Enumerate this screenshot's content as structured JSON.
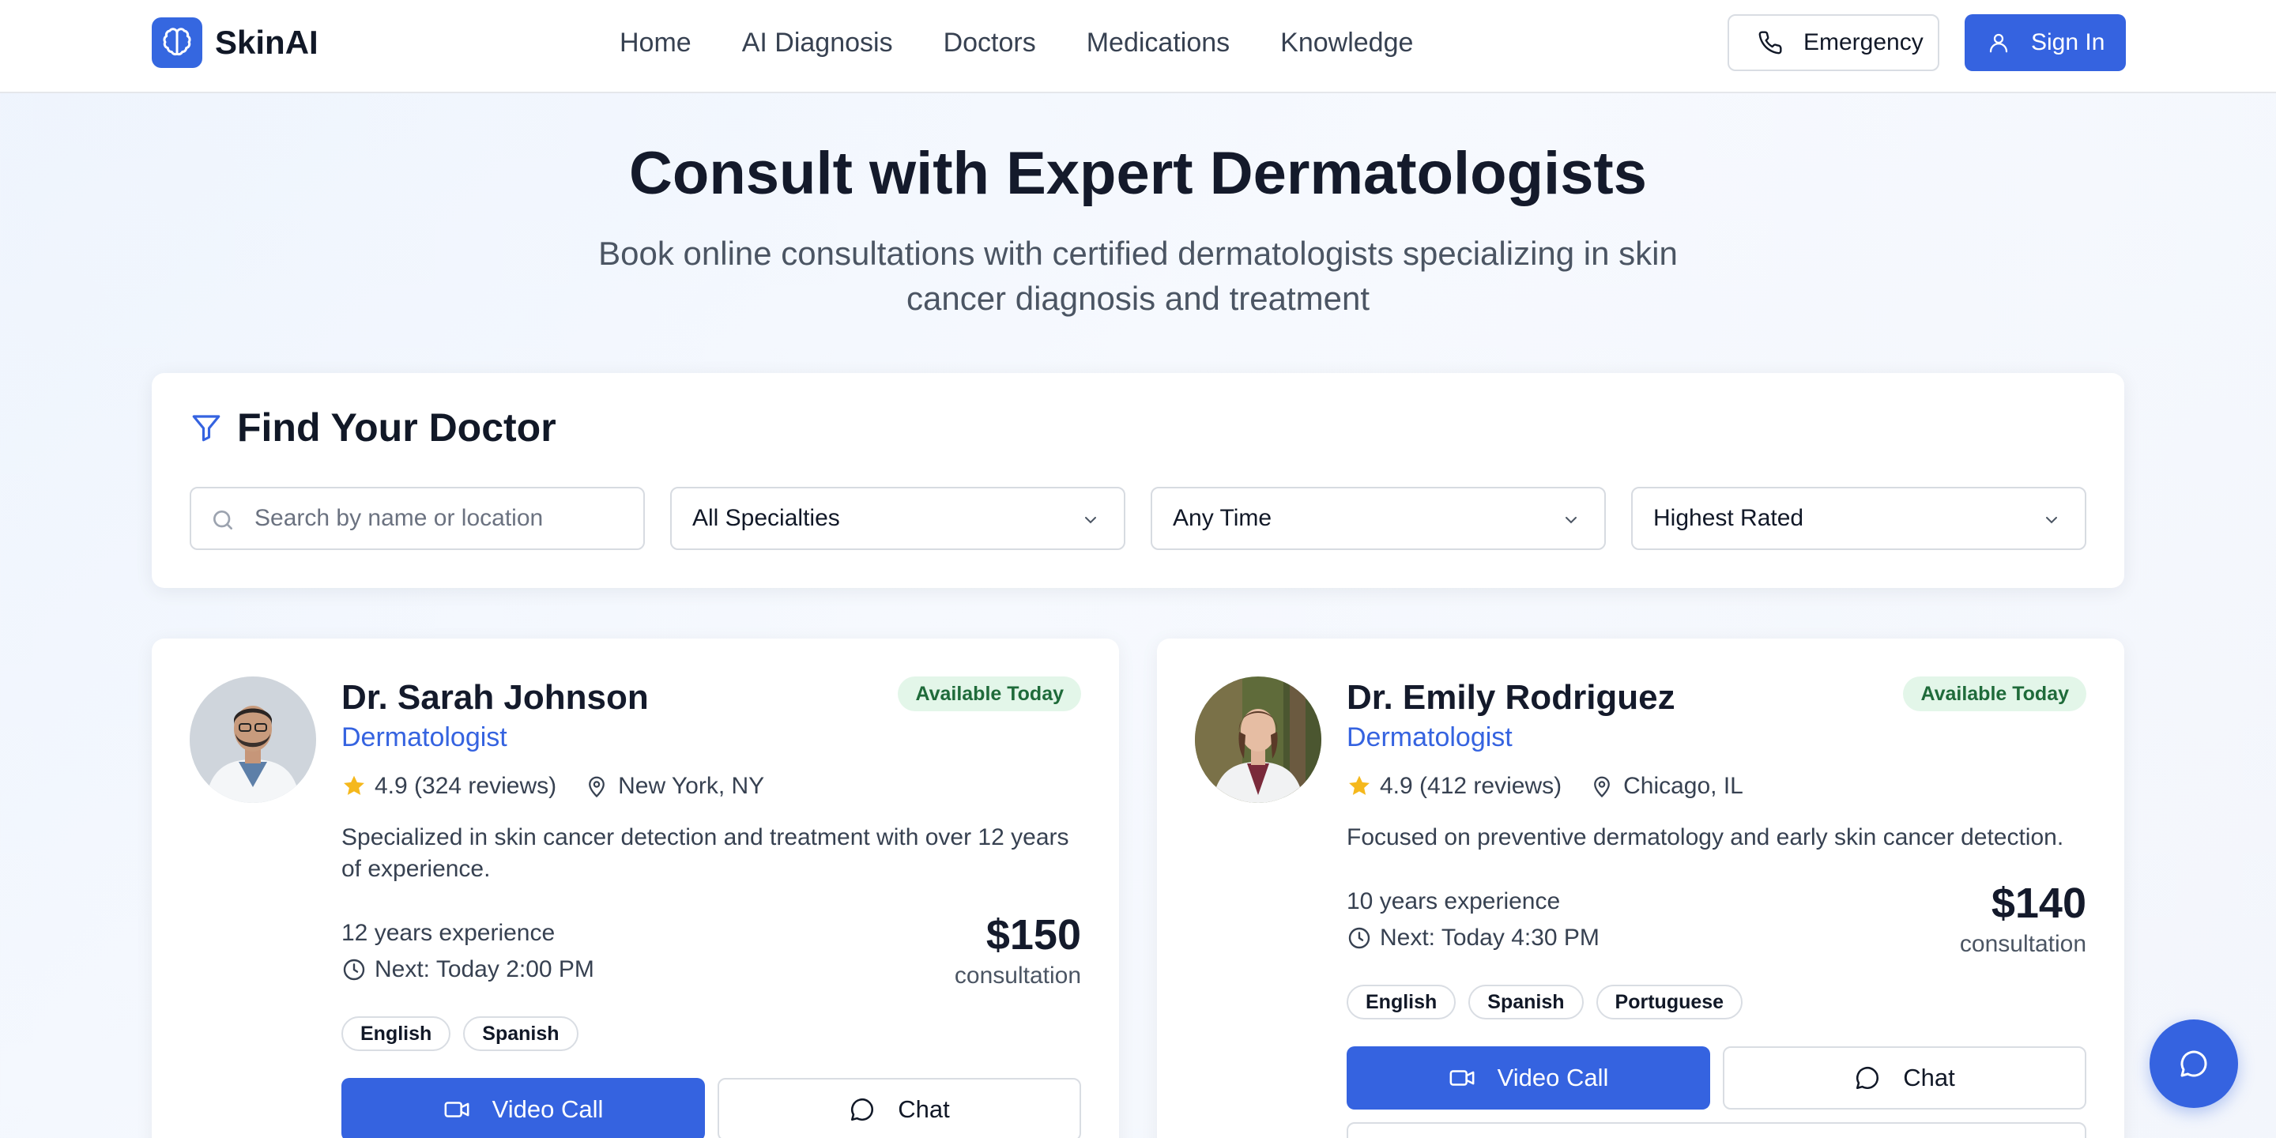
{
  "header": {
    "logo_text": "SkinAI",
    "nav": [
      "Home",
      "AI Diagnosis",
      "Doctors",
      "Medications",
      "Knowledge"
    ],
    "emergency_label": "Emergency",
    "signin_label": "Sign In"
  },
  "hero": {
    "title": "Consult with Expert Dermatologists",
    "subtitle": "Book online consultations with certified dermatologists specializing in skin cancer diagnosis and treatment"
  },
  "filters": {
    "title": "Find Your Doctor",
    "search_placeholder": "Search by name or location",
    "specialty": "All Specialties",
    "time": "Any Time",
    "sort": "Highest Rated"
  },
  "doctors": [
    {
      "name": "Dr. Sarah Johnson",
      "specialty": "Dermatologist",
      "badge": "Available Today",
      "rating": "4.9 (324 reviews)",
      "location": "New York, NY",
      "description": "Specialized in skin cancer detection and treatment with over 12 years of experience.",
      "experience": "12 years experience",
      "next": "Next: Today 2:00 PM",
      "price": "$150",
      "price_unit": "consultation",
      "languages": [
        "English",
        "Spanish"
      ],
      "video_label": "Video Call",
      "chat_label": "Chat"
    },
    {
      "name": "Dr. Emily Rodriguez",
      "specialty": "Dermatologist",
      "badge": "Available Today",
      "rating": "4.9 (412 reviews)",
      "location": "Chicago, IL",
      "description": "Focused on preventive dermatology and early skin cancer detection.",
      "experience": "10 years experience",
      "next": "Next: Today 4:30 PM",
      "price": "$140",
      "price_unit": "consultation",
      "languages": [
        "English",
        "Spanish",
        "Portuguese"
      ],
      "video_label": "Video Call",
      "chat_label": "Chat"
    }
  ],
  "colors": {
    "primary": "#3563e0",
    "badge_bg": "#e3f6e9",
    "badge_text": "#1f6b3a",
    "star": "#f5b81c"
  }
}
